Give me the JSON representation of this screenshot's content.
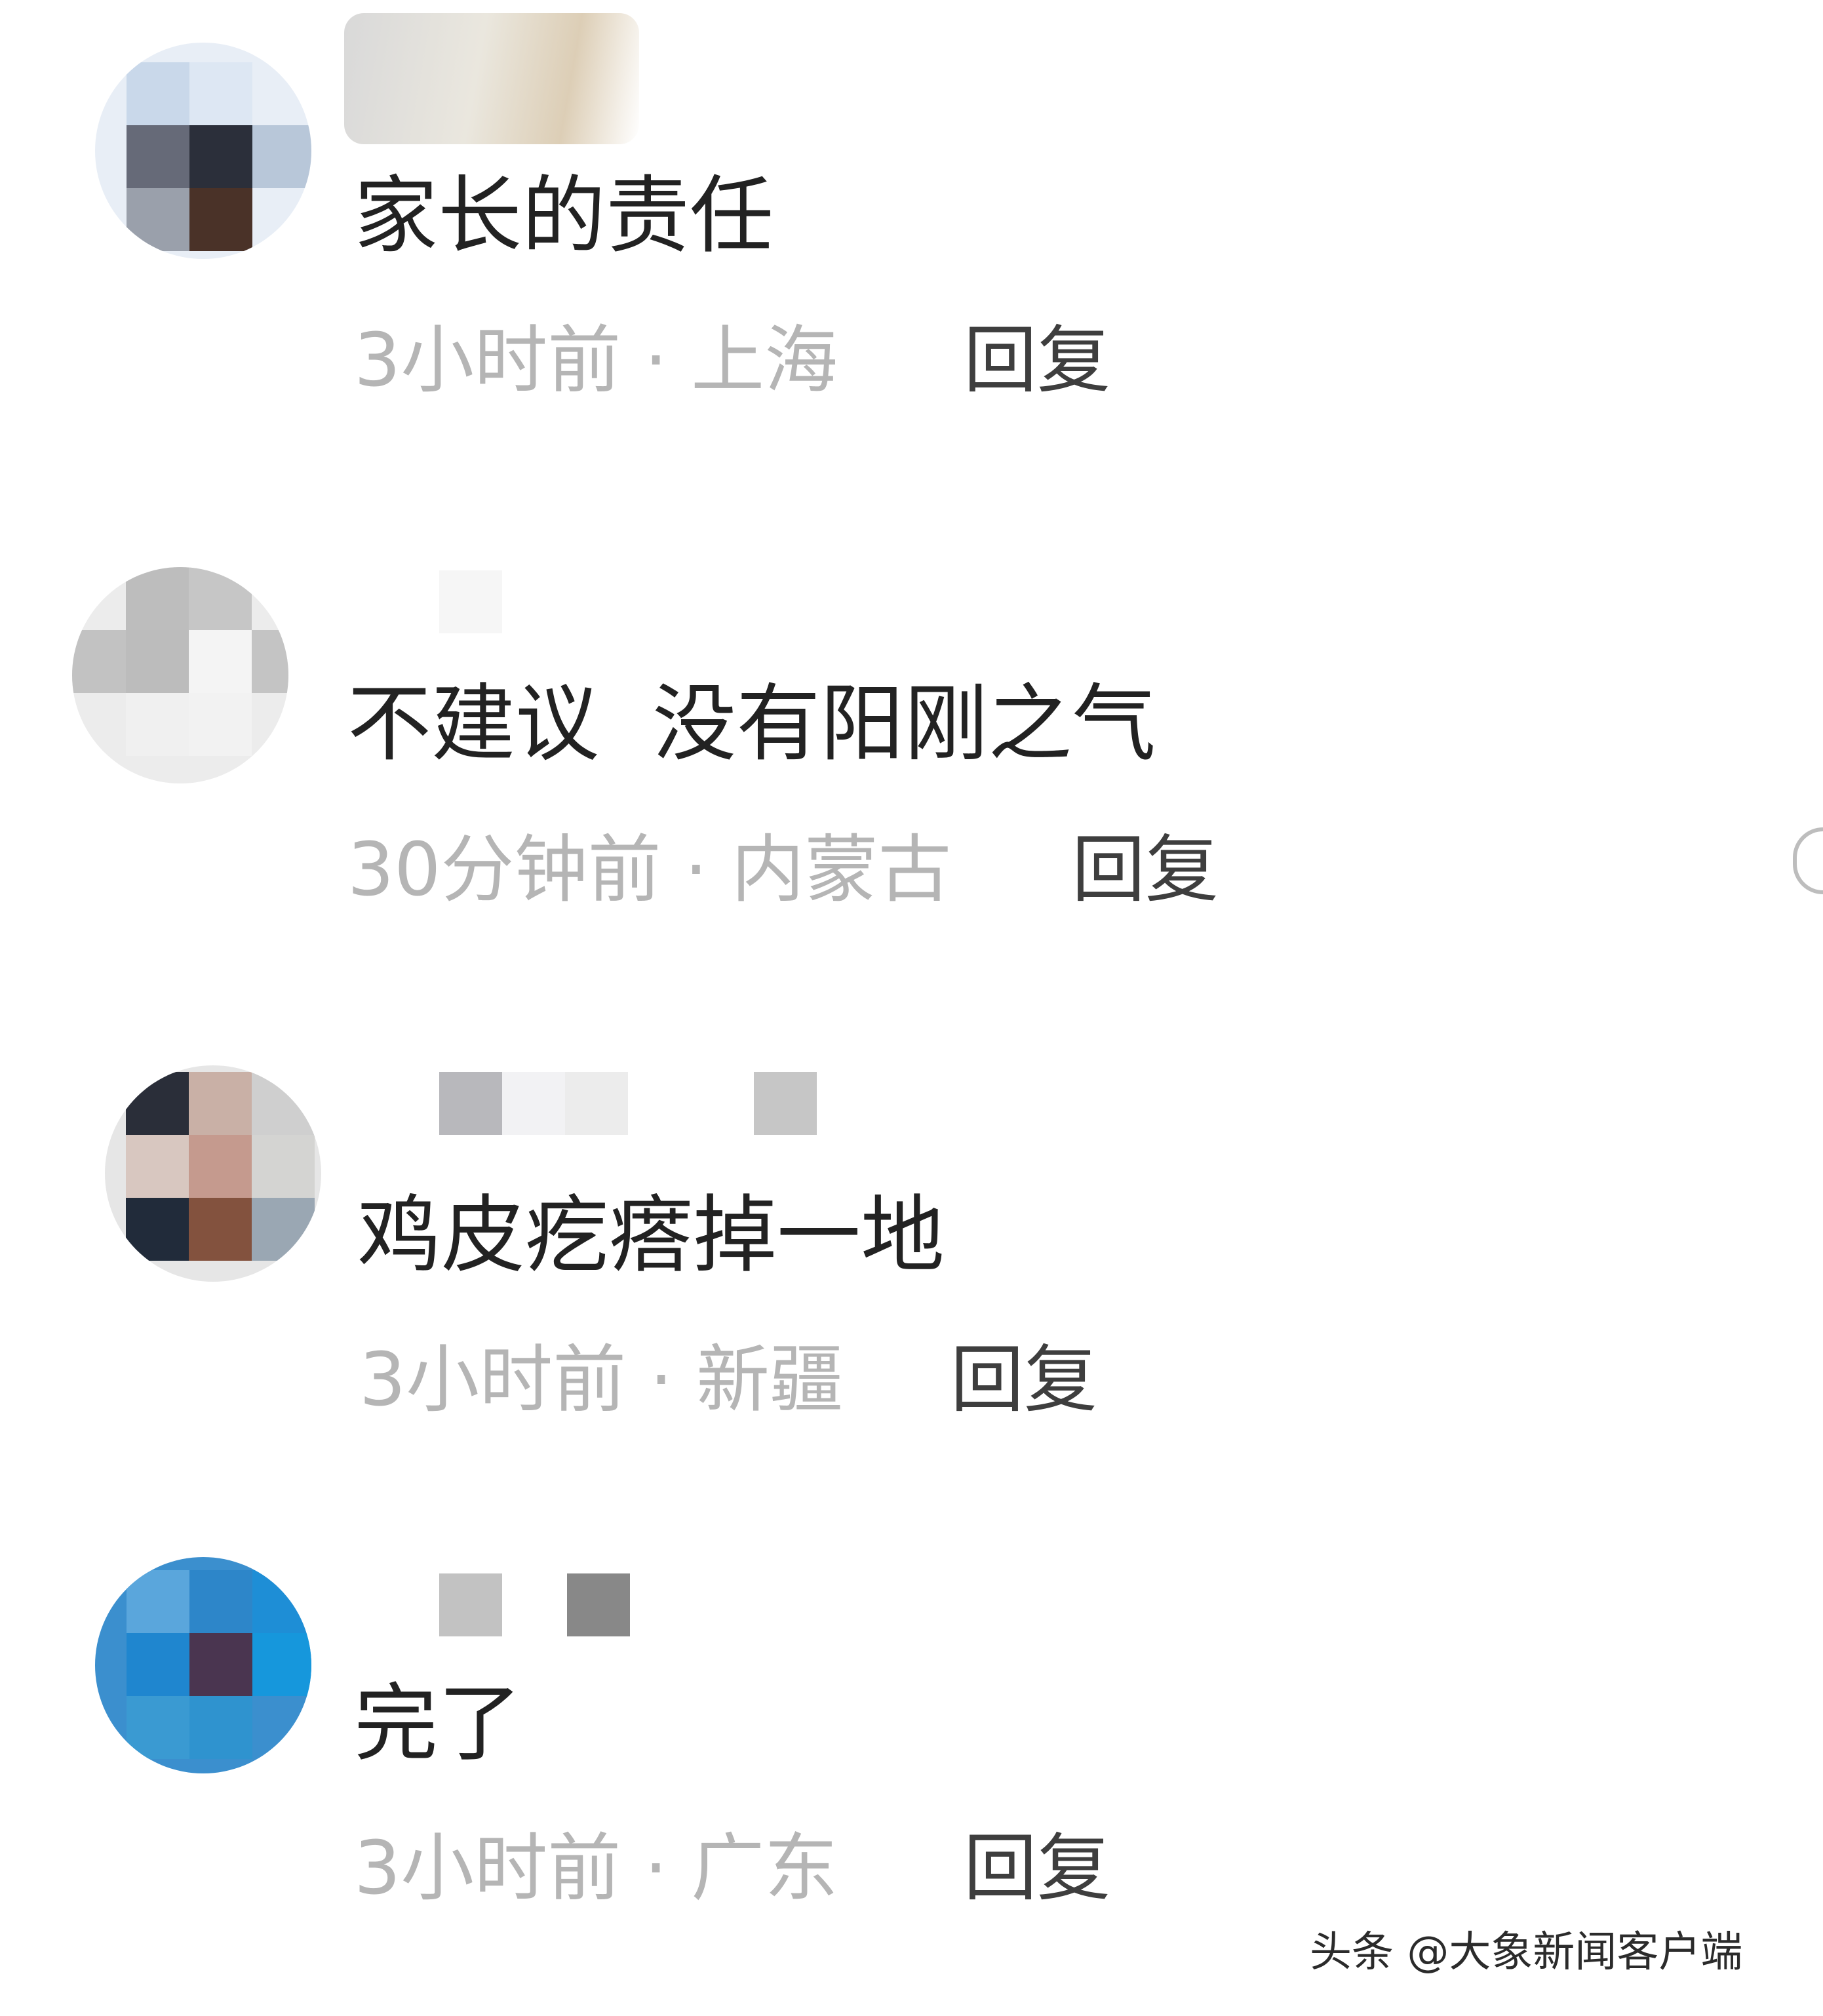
{
  "comments": [
    {
      "content": "家长的责任",
      "time": "3小时前",
      "location": "上海",
      "separator": " · ",
      "reply_label": "回复"
    },
    {
      "content": "不建议  没有阳刚之气",
      "time": "30分钟前",
      "location": "内蒙古",
      "separator": " · ",
      "reply_label": "回复"
    },
    {
      "content": "鸡皮疙瘩掉一地",
      "time": "3小时前",
      "location": "新疆",
      "separator": " · ",
      "reply_label": "回复"
    },
    {
      "content": "完了",
      "time": "3小时前",
      "location": "广东",
      "separator": " · ",
      "reply_label": "回复"
    }
  ],
  "watermark": "头条 @大象新闻客户端",
  "colors": {
    "content_text": "#222222",
    "meta_text": "#b5b5b5",
    "reply_text": "#3e3e3e",
    "background": "#ffffff"
  }
}
